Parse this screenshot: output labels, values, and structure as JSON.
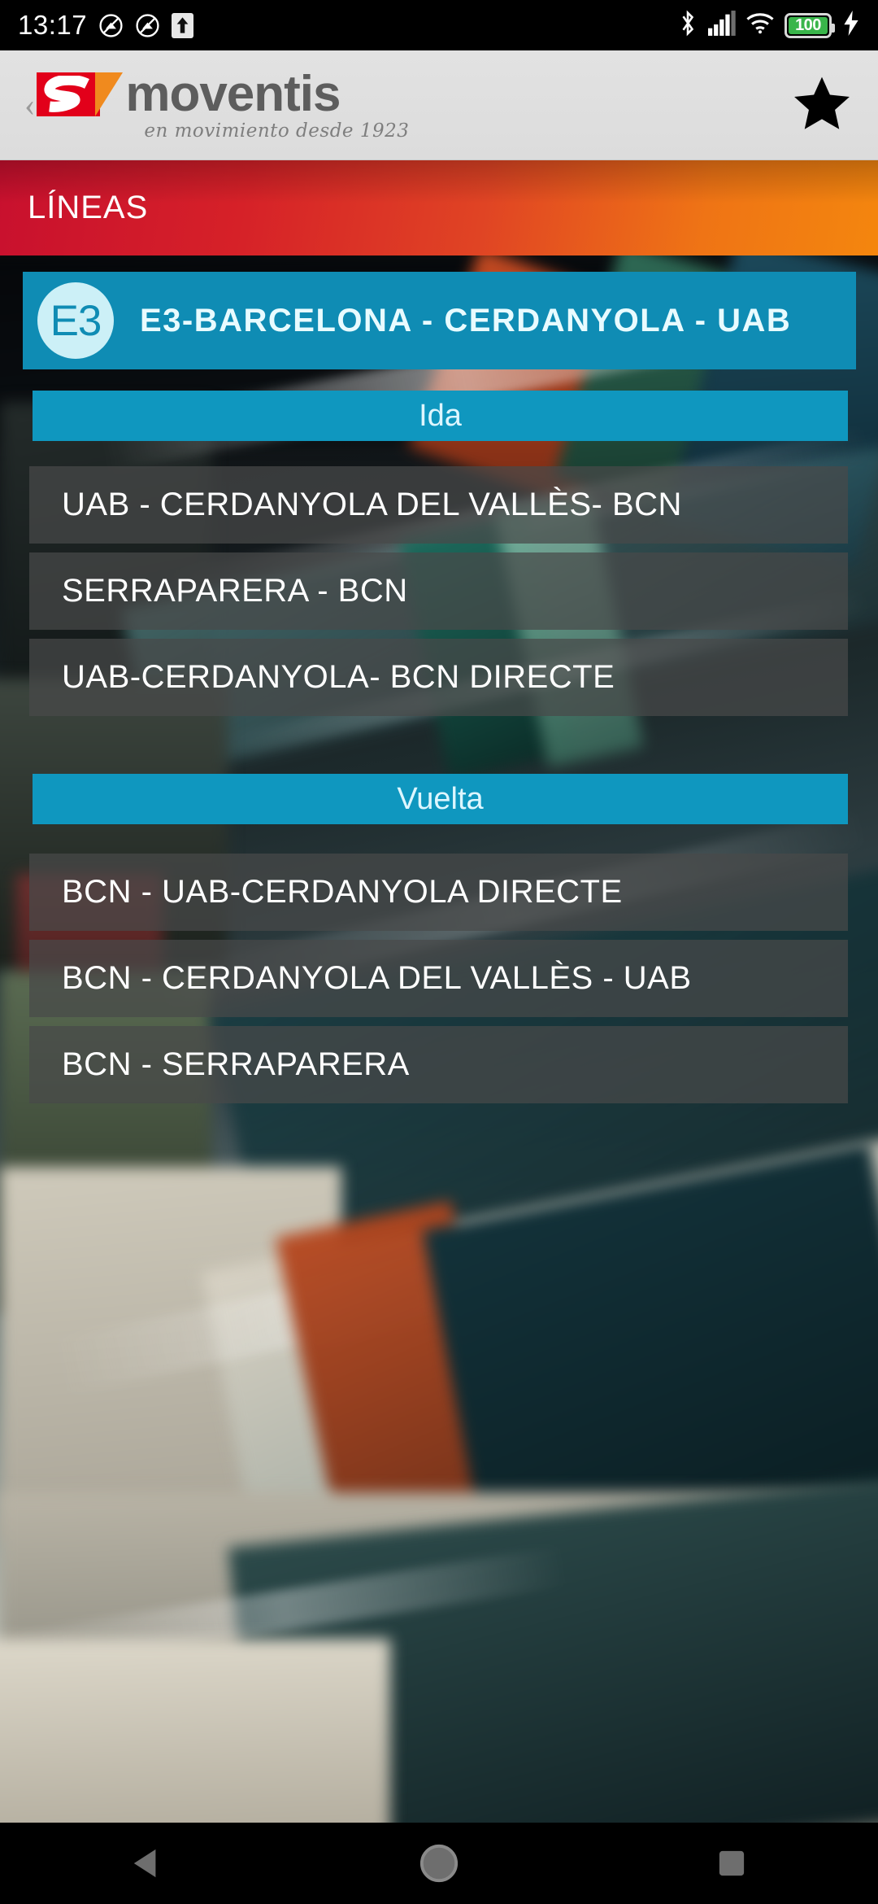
{
  "status_bar": {
    "time": "13:17",
    "battery_level": "100",
    "icons_left": [
      "do-not-disturb-icon",
      "do-not-disturb-icon",
      "upload-arrow-icon"
    ],
    "icons_right": [
      "bluetooth-icon",
      "signal-icon",
      "wifi-icon",
      "battery-icon",
      "charging-bolt-icon"
    ]
  },
  "app_header": {
    "back_label": "‹",
    "logo_text": "moventis",
    "logo_tagline": "en movimiento desde 1923",
    "favorite_icon": "star-icon"
  },
  "banner": {
    "title": "LÍNEAS",
    "gradient_start": "#c8102e",
    "gradient_end": "#f4860e"
  },
  "line": {
    "code": "E3",
    "title": "E3-BARCELONA - CERDANYOLA - UAB",
    "card_color": "#0f8cb4",
    "badge_bg": "#ccf0f7"
  },
  "sections": [
    {
      "label": "Ida",
      "routes": [
        "UAB - CERDANYOLA DEL VALLÈS- BCN",
        "SERRAPARERA - BCN",
        "UAB-CERDANYOLA- BCN DIRECTE"
      ]
    },
    {
      "label": "Vuelta",
      "routes": [
        "BCN - UAB-CERDANYOLA DIRECTE",
        "BCN - CERDANYOLA DEL VALLÈS - UAB",
        "BCN - SERRAPARERA"
      ]
    }
  ],
  "nav_bar": {
    "back": "back-triangle-icon",
    "home": "home-circle-icon",
    "recents": "recents-square-icon"
  }
}
